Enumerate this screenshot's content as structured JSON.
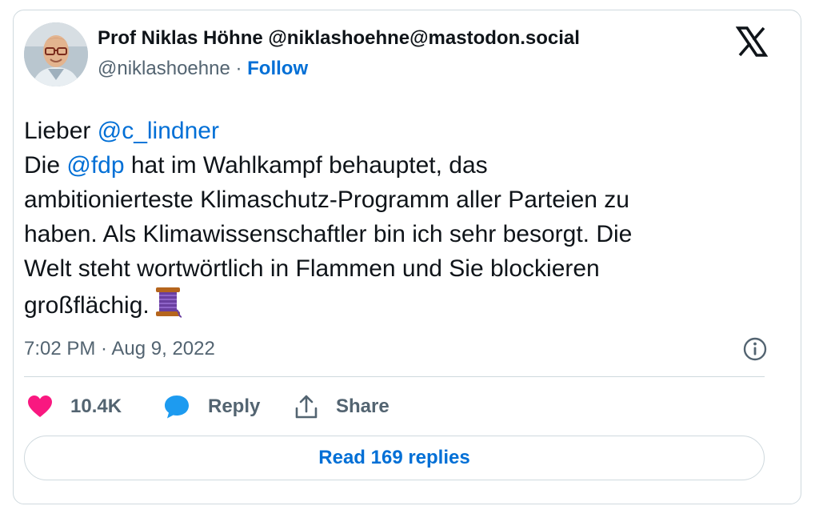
{
  "author": {
    "display_name": "Prof Niklas Höhne @niklashoehne@mastodon.social",
    "handle": "@niklashoehne",
    "separator": " · ",
    "follow_label": "Follow",
    "avatar_icon": "profile-photo"
  },
  "platform": {
    "logo_icon": "x-logo-icon"
  },
  "tweet": {
    "greeting": "Lieber ",
    "mention_1": "@c_lindner",
    "line2_prefix": "Die ",
    "mention_2": "@fdp",
    "line2_suffix": " hat im Wahlkampf behauptet, das",
    "line3": "ambitionierteste Klimaschutz-Programm aller Parteien zu",
    "line4": "haben. Als Klimawissenschaftler bin ich sehr besorgt. Die",
    "line5": "Welt steht wortwörtlich in Flammen und Sie blockieren",
    "line6": "großflächig.",
    "emoji": "thread-spool-emoji"
  },
  "meta": {
    "timestamp": "7:02 PM · Aug 9, 2022",
    "info_icon": "info-icon"
  },
  "actions": {
    "like_count": "10.4K",
    "reply_label": "Reply",
    "share_label": "Share"
  },
  "read_replies_label": "Read 169 replies",
  "colors": {
    "link": "#006fd6",
    "text": "#0f1419",
    "secondary": "#536471",
    "border": "#cfd9de",
    "like": "#f91880",
    "reply": "#1d9bf0"
  }
}
